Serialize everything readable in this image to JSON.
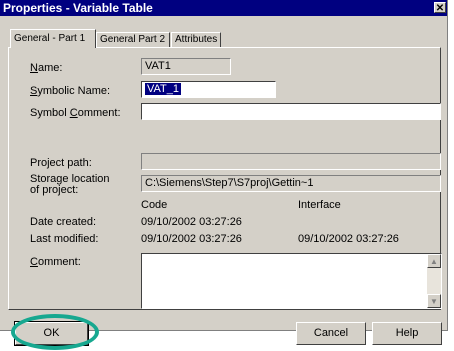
{
  "window": {
    "title": "Properties - Variable Table"
  },
  "tabs": [
    {
      "label": "General - Part 1",
      "active": true
    },
    {
      "label": "General  Part 2",
      "active": false
    },
    {
      "label": "Attributes",
      "active": false
    }
  ],
  "fields": {
    "name_label_u": "N",
    "name_label_rest": "ame:",
    "name_value": "VAT1",
    "symbolic_label_u": "S",
    "symbolic_label_rest": "ymbolic Name:",
    "symbolic_value": "VAT_1",
    "comment_label_pre": "Symbol ",
    "comment_label_u": "C",
    "comment_label_rest": "omment:",
    "comment_value": "",
    "project_path_label": "Project path:",
    "project_path_value": "",
    "storage_label_line1": "Storage location",
    "storage_label_line2": "of project:",
    "storage_value": "C:\\Siemens\\Step7\\S7proj\\Gettin~1"
  },
  "dates": {
    "code_header": "Code",
    "interface_header": "Interface",
    "created_label": "Date created:",
    "created_code": "09/10/2002  03:27:26",
    "modified_label": "Last modified:",
    "modified_code": "09/10/2002  03:27:26",
    "modified_interface": "09/10/2002  03:27:26"
  },
  "memo": {
    "label_u": "C",
    "label_rest": "omment:",
    "value": ""
  },
  "buttons": {
    "ok": "OK",
    "cancel": "Cancel",
    "help": "Help"
  },
  "icons": {
    "close": "close-icon",
    "scroll_up": "scroll-up-icon",
    "scroll_down": "scroll-down-icon"
  },
  "colors": {
    "titlebar": "#000080",
    "dialog": "#d4d0c8",
    "highlight_ring": "#17a890"
  }
}
